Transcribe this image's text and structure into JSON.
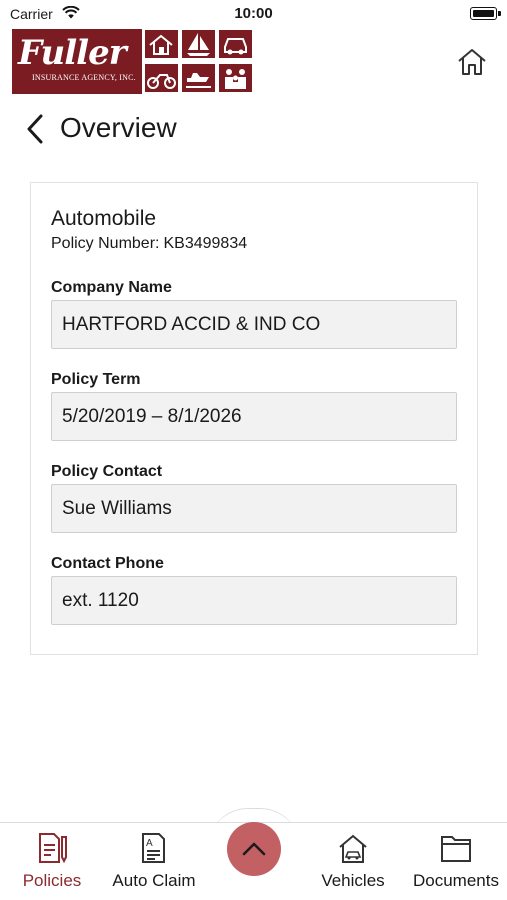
{
  "status_bar": {
    "carrier": "Carrier",
    "time": "10:00"
  },
  "header": {
    "logo_script": "Fuller",
    "logo_sub": "INSURANCE AGENCY, INC."
  },
  "page": {
    "title": "Overview"
  },
  "policy": {
    "type": "Automobile",
    "number_label": "Policy Number:",
    "number": "KB3499834",
    "fields": [
      {
        "label": "Company Name",
        "value": "HARTFORD ACCID & IND CO"
      },
      {
        "label": "Policy Term",
        "value": "5/20/2019 – 8/1/2026"
      },
      {
        "label": "Policy Contact",
        "value": "Sue Williams"
      },
      {
        "label": "Contact Phone",
        "value": "ext. 1120"
      }
    ]
  },
  "tabbar": {
    "tabs": [
      {
        "label": "Policies",
        "icon": "policies-icon",
        "active": true
      },
      {
        "label": "Auto Claim",
        "icon": "auto-claim-icon"
      },
      {
        "label": "Vehicles",
        "icon": "vehicles-icon"
      },
      {
        "label": "Documents",
        "icon": "documents-icon"
      }
    ],
    "center_icon": "chevron-up-icon"
  },
  "colors": {
    "accent": "#8b2a2f",
    "brand": "#7a1c22",
    "center_button": "#c26064"
  }
}
